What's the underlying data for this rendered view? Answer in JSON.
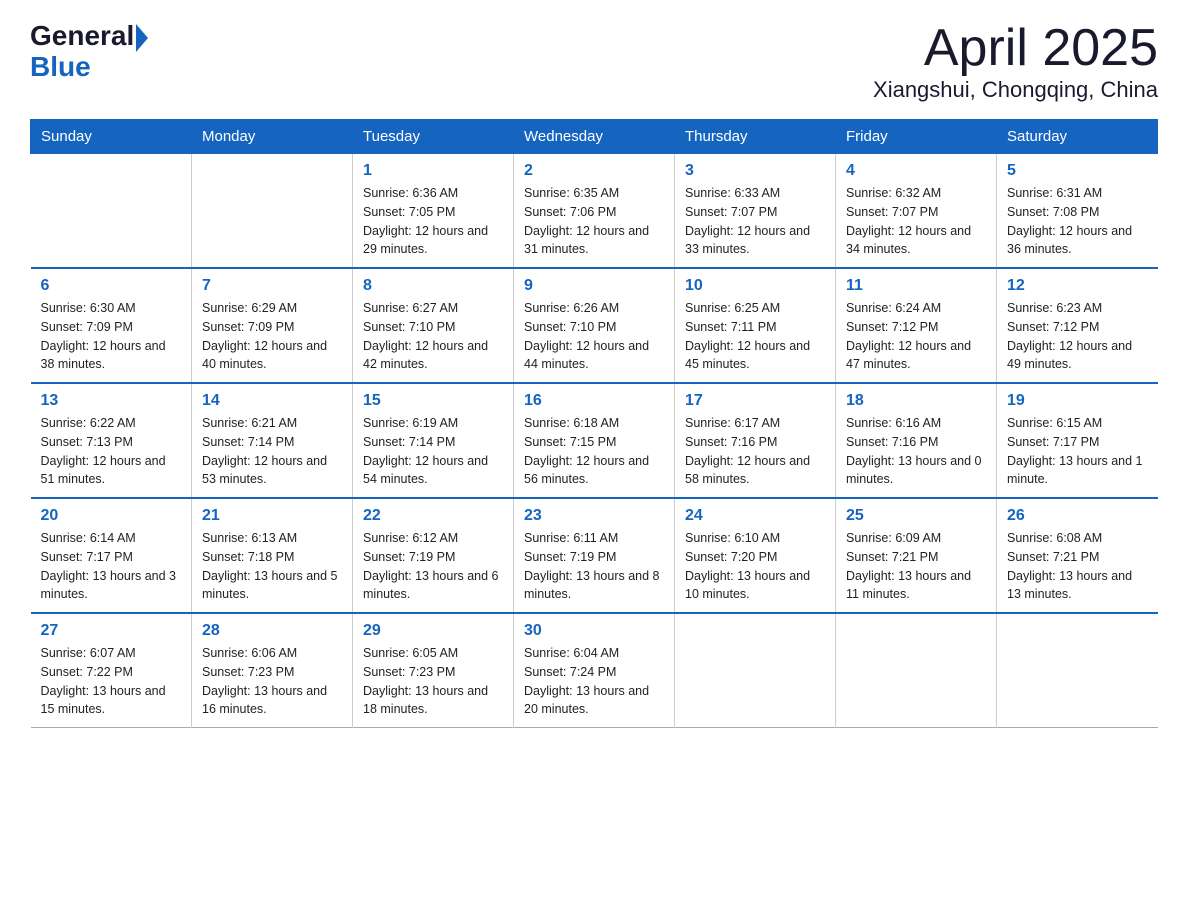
{
  "header": {
    "logo_general": "General",
    "logo_blue": "Blue",
    "title": "April 2025",
    "subtitle": "Xiangshui, Chongqing, China"
  },
  "days_of_week": [
    "Sunday",
    "Monday",
    "Tuesday",
    "Wednesday",
    "Thursday",
    "Friday",
    "Saturday"
  ],
  "weeks": [
    [
      {
        "day": "",
        "sunrise": "",
        "sunset": "",
        "daylight": ""
      },
      {
        "day": "",
        "sunrise": "",
        "sunset": "",
        "daylight": ""
      },
      {
        "day": "1",
        "sunrise": "Sunrise: 6:36 AM",
        "sunset": "Sunset: 7:05 PM",
        "daylight": "Daylight: 12 hours and 29 minutes."
      },
      {
        "day": "2",
        "sunrise": "Sunrise: 6:35 AM",
        "sunset": "Sunset: 7:06 PM",
        "daylight": "Daylight: 12 hours and 31 minutes."
      },
      {
        "day": "3",
        "sunrise": "Sunrise: 6:33 AM",
        "sunset": "Sunset: 7:07 PM",
        "daylight": "Daylight: 12 hours and 33 minutes."
      },
      {
        "day": "4",
        "sunrise": "Sunrise: 6:32 AM",
        "sunset": "Sunset: 7:07 PM",
        "daylight": "Daylight: 12 hours and 34 minutes."
      },
      {
        "day": "5",
        "sunrise": "Sunrise: 6:31 AM",
        "sunset": "Sunset: 7:08 PM",
        "daylight": "Daylight: 12 hours and 36 minutes."
      }
    ],
    [
      {
        "day": "6",
        "sunrise": "Sunrise: 6:30 AM",
        "sunset": "Sunset: 7:09 PM",
        "daylight": "Daylight: 12 hours and 38 minutes."
      },
      {
        "day": "7",
        "sunrise": "Sunrise: 6:29 AM",
        "sunset": "Sunset: 7:09 PM",
        "daylight": "Daylight: 12 hours and 40 minutes."
      },
      {
        "day": "8",
        "sunrise": "Sunrise: 6:27 AM",
        "sunset": "Sunset: 7:10 PM",
        "daylight": "Daylight: 12 hours and 42 minutes."
      },
      {
        "day": "9",
        "sunrise": "Sunrise: 6:26 AM",
        "sunset": "Sunset: 7:10 PM",
        "daylight": "Daylight: 12 hours and 44 minutes."
      },
      {
        "day": "10",
        "sunrise": "Sunrise: 6:25 AM",
        "sunset": "Sunset: 7:11 PM",
        "daylight": "Daylight: 12 hours and 45 minutes."
      },
      {
        "day": "11",
        "sunrise": "Sunrise: 6:24 AM",
        "sunset": "Sunset: 7:12 PM",
        "daylight": "Daylight: 12 hours and 47 minutes."
      },
      {
        "day": "12",
        "sunrise": "Sunrise: 6:23 AM",
        "sunset": "Sunset: 7:12 PM",
        "daylight": "Daylight: 12 hours and 49 minutes."
      }
    ],
    [
      {
        "day": "13",
        "sunrise": "Sunrise: 6:22 AM",
        "sunset": "Sunset: 7:13 PM",
        "daylight": "Daylight: 12 hours and 51 minutes."
      },
      {
        "day": "14",
        "sunrise": "Sunrise: 6:21 AM",
        "sunset": "Sunset: 7:14 PM",
        "daylight": "Daylight: 12 hours and 53 minutes."
      },
      {
        "day": "15",
        "sunrise": "Sunrise: 6:19 AM",
        "sunset": "Sunset: 7:14 PM",
        "daylight": "Daylight: 12 hours and 54 minutes."
      },
      {
        "day": "16",
        "sunrise": "Sunrise: 6:18 AM",
        "sunset": "Sunset: 7:15 PM",
        "daylight": "Daylight: 12 hours and 56 minutes."
      },
      {
        "day": "17",
        "sunrise": "Sunrise: 6:17 AM",
        "sunset": "Sunset: 7:16 PM",
        "daylight": "Daylight: 12 hours and 58 minutes."
      },
      {
        "day": "18",
        "sunrise": "Sunrise: 6:16 AM",
        "sunset": "Sunset: 7:16 PM",
        "daylight": "Daylight: 13 hours and 0 minutes."
      },
      {
        "day": "19",
        "sunrise": "Sunrise: 6:15 AM",
        "sunset": "Sunset: 7:17 PM",
        "daylight": "Daylight: 13 hours and 1 minute."
      }
    ],
    [
      {
        "day": "20",
        "sunrise": "Sunrise: 6:14 AM",
        "sunset": "Sunset: 7:17 PM",
        "daylight": "Daylight: 13 hours and 3 minutes."
      },
      {
        "day": "21",
        "sunrise": "Sunrise: 6:13 AM",
        "sunset": "Sunset: 7:18 PM",
        "daylight": "Daylight: 13 hours and 5 minutes."
      },
      {
        "day": "22",
        "sunrise": "Sunrise: 6:12 AM",
        "sunset": "Sunset: 7:19 PM",
        "daylight": "Daylight: 13 hours and 6 minutes."
      },
      {
        "day": "23",
        "sunrise": "Sunrise: 6:11 AM",
        "sunset": "Sunset: 7:19 PM",
        "daylight": "Daylight: 13 hours and 8 minutes."
      },
      {
        "day": "24",
        "sunrise": "Sunrise: 6:10 AM",
        "sunset": "Sunset: 7:20 PM",
        "daylight": "Daylight: 13 hours and 10 minutes."
      },
      {
        "day": "25",
        "sunrise": "Sunrise: 6:09 AM",
        "sunset": "Sunset: 7:21 PM",
        "daylight": "Daylight: 13 hours and 11 minutes."
      },
      {
        "day": "26",
        "sunrise": "Sunrise: 6:08 AM",
        "sunset": "Sunset: 7:21 PM",
        "daylight": "Daylight: 13 hours and 13 minutes."
      }
    ],
    [
      {
        "day": "27",
        "sunrise": "Sunrise: 6:07 AM",
        "sunset": "Sunset: 7:22 PM",
        "daylight": "Daylight: 13 hours and 15 minutes."
      },
      {
        "day": "28",
        "sunrise": "Sunrise: 6:06 AM",
        "sunset": "Sunset: 7:23 PM",
        "daylight": "Daylight: 13 hours and 16 minutes."
      },
      {
        "day": "29",
        "sunrise": "Sunrise: 6:05 AM",
        "sunset": "Sunset: 7:23 PM",
        "daylight": "Daylight: 13 hours and 18 minutes."
      },
      {
        "day": "30",
        "sunrise": "Sunrise: 6:04 AM",
        "sunset": "Sunset: 7:24 PM",
        "daylight": "Daylight: 13 hours and 20 minutes."
      },
      {
        "day": "",
        "sunrise": "",
        "sunset": "",
        "daylight": ""
      },
      {
        "day": "",
        "sunrise": "",
        "sunset": "",
        "daylight": ""
      },
      {
        "day": "",
        "sunrise": "",
        "sunset": "",
        "daylight": ""
      }
    ]
  ]
}
